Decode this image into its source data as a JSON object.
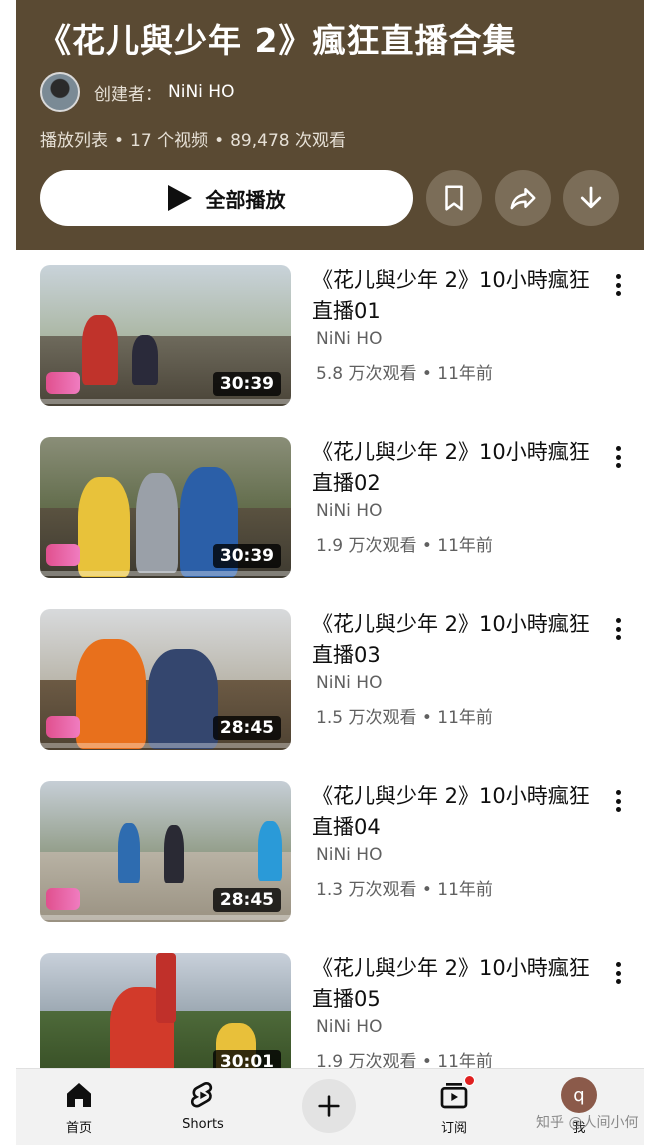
{
  "playlist": {
    "title": "《花儿與少年 2》瘋狂直播合集",
    "creator_label": "创建者：",
    "creator_name": "NiNi HO",
    "type": "播放列表",
    "video_count": "17 个视频",
    "views": "89,478 次观看",
    "play_all_label": "全部播放",
    "header_color": "#5a4a33"
  },
  "actions": {
    "save_icon": "bookmark-icon",
    "share_icon": "share-icon",
    "download_icon": "download-icon"
  },
  "videos": [
    {
      "title": "《花儿與少年 2》10小時瘋狂直播01",
      "channel": "NiNi HO",
      "stats": "5.8 万次观看 • 11年前",
      "duration": "30:39"
    },
    {
      "title": "《花儿與少年 2》10小時瘋狂直播02",
      "channel": "NiNi HO",
      "stats": "1.9 万次观看 • 11年前",
      "duration": "30:39"
    },
    {
      "title": "《花儿與少年 2》10小時瘋狂直播03",
      "channel": "NiNi HO",
      "stats": "1.5 万次观看 • 11年前",
      "duration": "28:45"
    },
    {
      "title": "《花儿與少年 2》10小時瘋狂直播04",
      "channel": "NiNi HO",
      "stats": "1.3 万次观看 • 11年前",
      "duration": "28:45"
    },
    {
      "title": "《花儿與少年 2》10小時瘋狂直播05",
      "channel": "NiNi HO",
      "stats": "1.9 万次观看 • 11年前",
      "duration": "30:01"
    }
  ],
  "nav": {
    "home_label": "首页",
    "shorts_label": "Shorts",
    "subs_label": "订阅",
    "you_label": "我",
    "you_initial": "q"
  },
  "watermark": "知乎 @人间小何"
}
